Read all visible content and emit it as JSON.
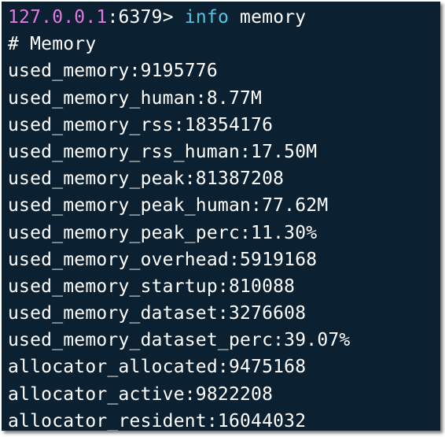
{
  "prompt": {
    "host": "127.0.0.1",
    "separator": ":",
    "port_and_marker": "6379> ",
    "command": "info",
    "argument": " memory"
  },
  "output": [
    "# Memory",
    "used_memory:9195776",
    "used_memory_human:8.77M",
    "used_memory_rss:18354176",
    "used_memory_rss_human:17.50M",
    "used_memory_peak:81387208",
    "used_memory_peak_human:77.62M",
    "used_memory_peak_perc:11.30%",
    "used_memory_overhead:5919168",
    "used_memory_startup:810088",
    "used_memory_dataset:3276608",
    "used_memory_dataset_perc:39.07%",
    "allocator_allocated:9475168",
    "allocator_active:9822208",
    "allocator_resident:16044032"
  ],
  "colors": {
    "background": "#0b2030",
    "host": "#e278e0",
    "command": "#4fc7e6",
    "text": "#ffffff"
  }
}
